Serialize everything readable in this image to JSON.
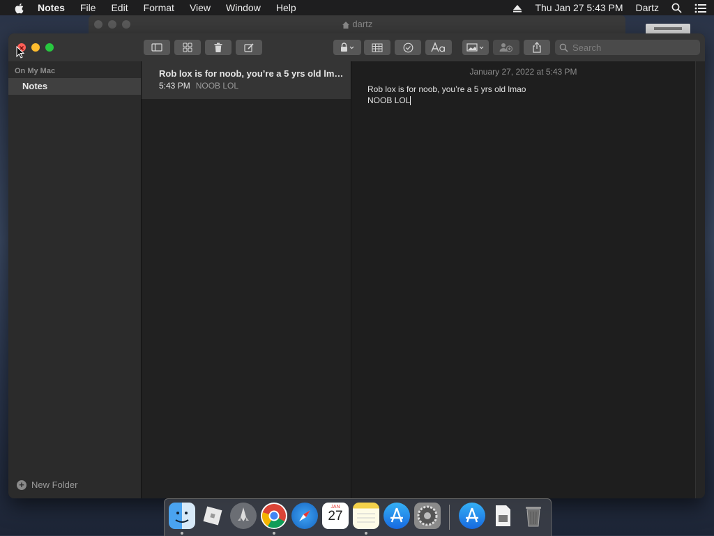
{
  "menubar": {
    "app_name": "Notes",
    "items": [
      "File",
      "Edit",
      "Format",
      "View",
      "Window",
      "Help"
    ],
    "datetime": "Thu Jan 27  5:43 PM",
    "user": "Dartz"
  },
  "background_window": {
    "title": "dartz"
  },
  "toolbar": {
    "search_placeholder": "Search"
  },
  "sidebar": {
    "section_label": "On My Mac",
    "folders": [
      {
        "label": "Notes"
      }
    ],
    "new_folder_label": "New Folder"
  },
  "note_list": [
    {
      "title": "Rob lox is for noob, you’re a 5 yrs old lmao",
      "time": "5:43 PM",
      "preview": "NOOB LOL"
    }
  ],
  "editor": {
    "date": "January 27, 2022 at 5:43 PM",
    "lines": [
      "Rob lox is for noob, you’re a 5 yrs old lmao",
      "NOOB LOL"
    ]
  },
  "dock": {
    "apps": [
      "Finder",
      "Roblox",
      "Launchpad",
      "Google Chrome",
      "Safari",
      "Calendar",
      "Notes",
      "App Store",
      "System Preferences",
      "App Store Downloads",
      "Documents",
      "Trash"
    ],
    "calendar_month": "JAN",
    "calendar_day": "27"
  },
  "colors": {
    "close": "#ff5f57",
    "minimize": "#febc2e",
    "zoom": "#28c840"
  }
}
